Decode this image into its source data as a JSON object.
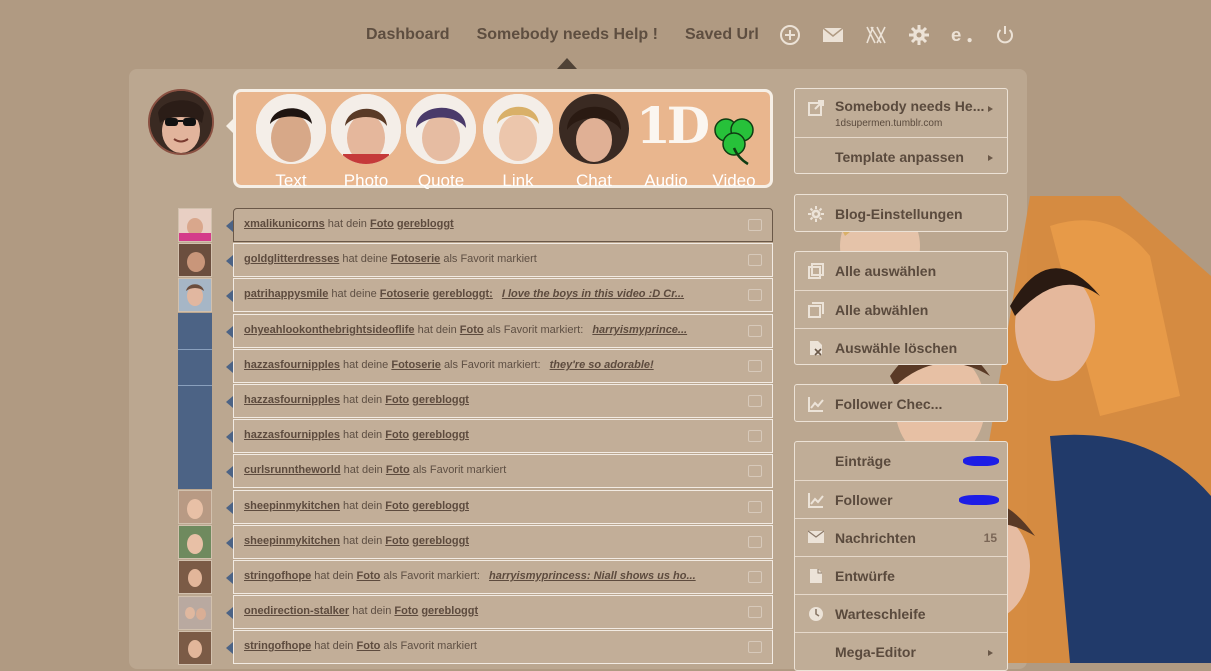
{
  "nav": {
    "links": [
      "Dashboard",
      "Somebody needs Help !",
      "Saved Url"
    ],
    "icons": [
      "plus-circle-icon",
      "mail-icon",
      "x-brand-icon",
      "gear-icon",
      "e-brand-icon",
      "power-icon"
    ]
  },
  "post_types": [
    {
      "label": "Text"
    },
    {
      "label": "Photo"
    },
    {
      "label": "Quote"
    },
    {
      "label": "Link"
    },
    {
      "label": "Chat"
    },
    {
      "label": "Audio",
      "badge": "1D"
    },
    {
      "label": "Video"
    }
  ],
  "activity": [
    {
      "user": "xmalikunicorns",
      "t1": "hat dein",
      "link": "Foto",
      "t2": "",
      "action": "gerebloggt",
      "quote": ""
    },
    {
      "user": "goldglitterdresses",
      "t1": "hat deine",
      "link": "Fotoserie",
      "t2": "als Favorit markiert",
      "action": "",
      "quote": ""
    },
    {
      "user": "patrihappysmile",
      "t1": "hat deine",
      "link": "Fotoserie",
      "t2": "",
      "action": "gerebloggt:",
      "quote": "I love the boys in this video :D Cr..."
    },
    {
      "user": "ohyeahlookonthebrightsideoflife",
      "t1": "hat dein",
      "link": "Foto",
      "t2": "als Favorit markiert:",
      "action": "",
      "quote": "harryismyprince..."
    },
    {
      "user": "hazzasfournipples",
      "t1": "hat deine",
      "link": "Fotoserie",
      "t2": "als Favorit markiert:",
      "action": "",
      "quote": "they're so adorable!"
    },
    {
      "user": "hazzasfournipples",
      "t1": "hat dein",
      "link": "Foto",
      "t2": "",
      "action": "gerebloggt",
      "quote": ""
    },
    {
      "user": "hazzasfournipples",
      "t1": "hat dein",
      "link": "Foto",
      "t2": "",
      "action": "gerebloggt",
      "quote": ""
    },
    {
      "user": "curlsrunntheworld",
      "t1": "hat dein",
      "link": "Foto",
      "t2": "als Favorit markiert",
      "action": "",
      "quote": ""
    },
    {
      "user": "sheepinmykitchen",
      "t1": "hat dein",
      "link": "Foto",
      "t2": "",
      "action": "gerebloggt",
      "quote": ""
    },
    {
      "user": "sheepinmykitchen",
      "t1": "hat dein",
      "link": "Foto",
      "t2": "",
      "action": "gerebloggt",
      "quote": ""
    },
    {
      "user": "stringofhope",
      "t1": "hat dein",
      "link": "Foto",
      "t2": "als Favorit markiert:",
      "action": "",
      "quote": "harryismyprincess: Niall shows us ho..."
    },
    {
      "user": "onedirection-stalker",
      "t1": "hat dein",
      "link": "Foto",
      "t2": "",
      "action": "gerebloggt",
      "quote": ""
    },
    {
      "user": "stringofhope",
      "t1": "hat dein",
      "link": "Foto",
      "t2": "als Favorit markiert",
      "action": "",
      "quote": ""
    }
  ],
  "sidebar": {
    "blog": {
      "title": "Somebody needs He...",
      "url": "1dsupermen.tumblr.com",
      "customize": "Template anpassen"
    },
    "settings": "Blog-Einstellungen",
    "select_all": "Alle auswählen",
    "deselect_all": "Alle abwählen",
    "delete_selected": "Auswähle löschen",
    "follower_check": "Follower Chec...",
    "stats": [
      {
        "label": "Einträge",
        "count": ""
      },
      {
        "label": "Follower",
        "count": ""
      },
      {
        "label": "Nachrichten",
        "count": "15"
      },
      {
        "label": "Entwürfe",
        "count": ""
      },
      {
        "label": "Warteschleife",
        "count": ""
      },
      {
        "label": "Mega-Editor",
        "count": ""
      }
    ]
  },
  "colors": {
    "background": "#b09a82",
    "panel": "#c2ae98",
    "accent_blue": "#4c6385",
    "scribble": "#1d1de6"
  }
}
